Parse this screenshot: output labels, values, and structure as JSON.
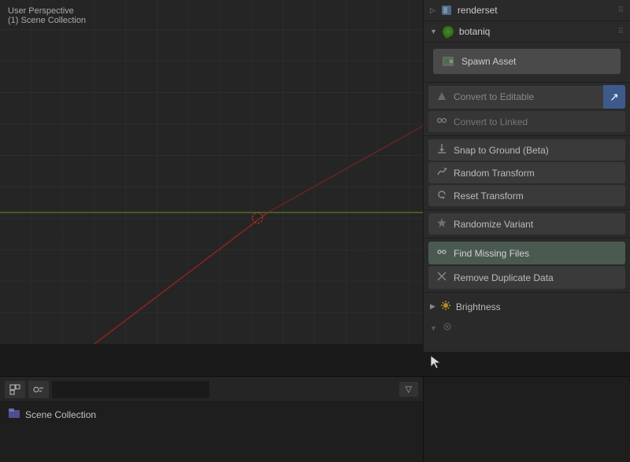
{
  "viewport": {
    "line1": "User Perspective",
    "line2": "(1) Scene Collection"
  },
  "panels": {
    "renderset": {
      "label": "renderset",
      "collapsed": true
    },
    "botaniq": {
      "label": "botaniq",
      "collapsed": false
    }
  },
  "buttons": {
    "spawn_asset": "Spawn Asset",
    "convert_editable": "Convert to Editable",
    "convert_linked": "Convert to Linked",
    "snap_to_ground": "Snap to Ground (Beta)",
    "random_transform": "Random Transform",
    "reset_transform": "Reset Transform",
    "randomize_variant": "Randomize Variant",
    "find_missing": "Find Missing Files",
    "remove_duplicate": "Remove Duplicate Data",
    "brightness": "Brightness"
  },
  "bottom": {
    "scene_collection": "Scene Collection",
    "filter_icon": "▽",
    "search_placeholder": ""
  },
  "icons": {
    "renderset": "▷",
    "botaniq": "▼",
    "drag": "⠿",
    "cube": "◻",
    "link": "⛓",
    "snap": "↓",
    "random": "⤮",
    "reset": "↺",
    "star": "✦",
    "find": "🔗",
    "remove": "⤡",
    "sun": "☀",
    "arrow_right": "▶",
    "collection": "📁",
    "blue_btn": "↗",
    "search": "🔍",
    "filter": "▽"
  }
}
